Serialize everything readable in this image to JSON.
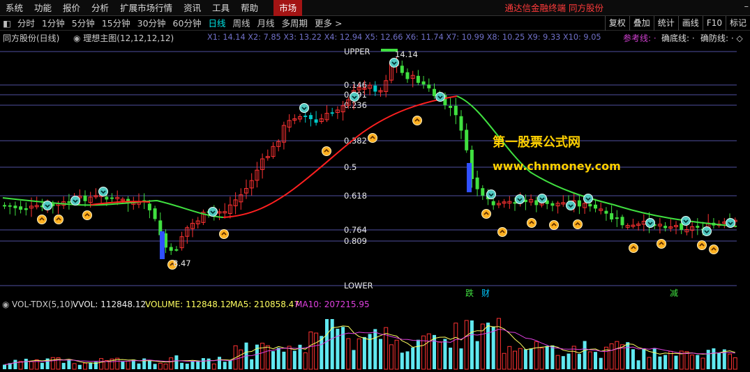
{
  "menu": {
    "items": [
      "系统",
      "功能",
      "报价",
      "分析",
      "扩展市场行情",
      "资讯",
      "工具",
      "帮助"
    ],
    "active": "市场",
    "title": "通达信金融终端  同方股份"
  },
  "periods": {
    "items": [
      "分时",
      "1分钟",
      "5分钟",
      "15分钟",
      "30分钟",
      "60分钟",
      "日线",
      "周线",
      "月线",
      "多周期",
      "更多 >"
    ],
    "active_index": 6
  },
  "toolbar": {
    "buttons": [
      "复权",
      "叠加",
      "统计",
      "画线",
      "F10",
      "标记"
    ]
  },
  "info": {
    "stock": "同方股份(日线)",
    "indicator": "理想主图(12,12,12,12)",
    "x_values": "X1: 14.14  X2: 7.85  X3: 13.22  X4: 12.94  X5: 12.66  X6: 11.74  X7: 10.99  X8: 10.25  X9: 9.33  X10: 9.05",
    "ref_line": "参考线: ·",
    "bottom_line": "确底线: ·",
    "defense_line": "确防线: · ◇"
  },
  "fib_levels": [
    {
      "label": "UPPER",
      "value": 0
    },
    {
      "label": "0.146",
      "value": 0.146
    },
    {
      "label": "0.191",
      "value": 0.191
    },
    {
      "label": "0.236",
      "value": 0.236
    },
    {
      "label": "0.382",
      "value": 0.382
    },
    {
      "label": "0.5",
      "value": 0.5
    },
    {
      "label": "0.618",
      "value": 0.618
    },
    {
      "label": "0.764",
      "value": 0.764
    },
    {
      "label": "0.809",
      "value": 0.809
    },
    {
      "label": "LOWER",
      "value": 1
    }
  ],
  "price_labels": {
    "high": "14.14",
    "low": "8.47"
  },
  "markers": {
    "die": "跌",
    "cai": "财",
    "jian": "减"
  },
  "watermark": {
    "line1": "第一股票公式网",
    "line2": "www.chnmoney.com"
  },
  "volume": {
    "indicator": "VOL-TDX(5,10)",
    "vvol": "VVOL: 112848.12",
    "volume": "VOLUME: 112848.12",
    "ma5": "MA5: 210858.47",
    "ma10": "MA10: 207215.95"
  },
  "colors": {
    "up": "#ff3232",
    "down": "#00c8c8",
    "ma_up": "#ff2020",
    "ma_down": "#40e040",
    "level_line": "#5050a0",
    "ma5": "#ffff60",
    "ma10": "#e040e0"
  }
}
